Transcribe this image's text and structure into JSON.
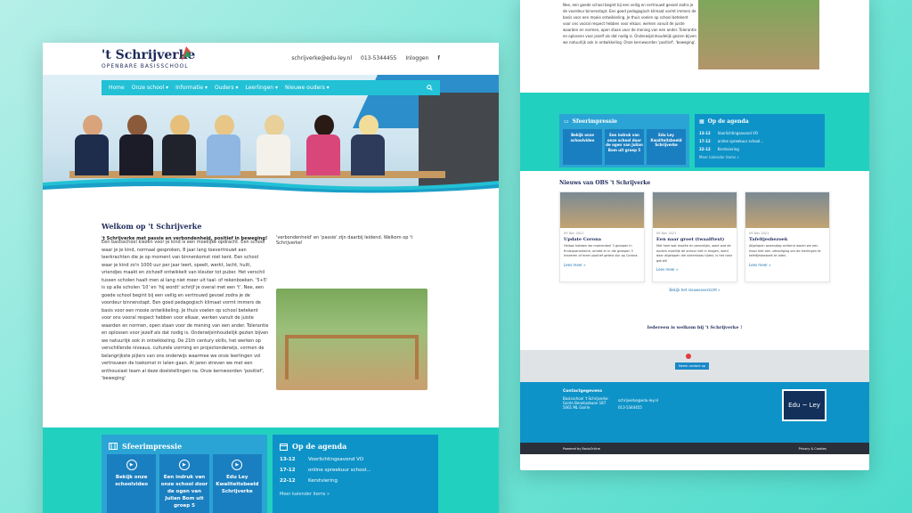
{
  "left": {
    "logo": {
      "name": "'t Schrijverke",
      "subtitle": "OPENBARE BASISSCHOOL"
    },
    "header": {
      "email": "schrijverke@edu-ley.nl",
      "phone": "013-5344455",
      "login": "Inloggen",
      "social": "f"
    },
    "nav": {
      "items": [
        "Home",
        "Onze school ▾",
        "Informatie ▾",
        "Ouders ▾",
        "Leerlingen ▾",
        "Nieuwe ouders ▾"
      ],
      "search_icon": "search-icon"
    },
    "welcome_title": "Welkom op 't Schrijverke",
    "tagline": "'t Schrijverke met passie en verbondenheid, positief in beweging!",
    "tagline2": "'verbondenheid' en 'passie' zijn daarbij leidend. Welkom op 't Schrijverke!",
    "body_text": "Een basisschool kiezen voor je kind is een moeilijke opdracht. Een school waar je je kind, normaal gesproken, 8 jaar lang toevertrouwt aan leerkrachten die je op moment van binnenkomst niet kent. Een school waar je kind zo'n 1000 uur per jaar leert, speelt, werkt, lacht, huilt, vriendjes maakt en zichzelf ontwikkelt van kleuter tot puber. Het verschil tussen scholen haalt men al lang niet meer uit taal- of rekenboeken. '5+5' is op alle scholen '10' en 'hij wordt' schrijf je overal met een 't'. Nee, een goede school begint bij een veilig en vertrouwd gevoel zodra je de voordeur binnenstapt. Een goed pedagogisch klimaat vormt immers de basis voor een mooie ontwikkeling. Je thuis voelen op school betekent voor ons vooral respect hebben voor elkaar, werken vanuit de juiste waarden en normen, open staan voor de mening van een ander. Tolerantie en oplossen voor jezelf als dat nodig is. Onderwijsinhoudelijk gezien bijven we natuurlijk ook in ontwikkeling. De 21th century skills, het werken op verschillende niveaus, culturele vorming en projectonderwijs, vormen de belangrijkste pijlers van ons onderwijs waarmee we onze leerlingen vol vertrouwen de toekomst in laten gaan. Al jaren streven we met een enthousiast team al deze doelstellingen na. Onze kernwoorden 'positief', 'beweging'",
    "sfeer": {
      "title": "Sfeerimpressie",
      "tiles": [
        "Bekijk onze schoolvideo",
        "Een indruk van onze school door de ogen van Julian Bom uit groep 5",
        "Edu Ley Kwaliteitsbeeld Schrijverke"
      ]
    },
    "agenda": {
      "title": "Op de agenda",
      "rows": [
        {
          "date": "13-12",
          "text": "Voorlichtingsavond VO"
        },
        {
          "date": "17-12",
          "text": "online spreekuur school..."
        },
        {
          "date": "22-12",
          "text": "Kerstviering"
        }
      ],
      "link": "Meer kalender items »"
    }
  },
  "right": {
    "intro_text": "Nee, een goede school begint bij een veilig en vertrouwd gevoel zodra je de voordeur binnenstapt. Een goed pedagogisch klimaat vormt immers de basis voor een mooie ontwikkeling. Je thuis voelen op school betekent voor ons vooral respect hebben voor elkaar, werken vanuit de juiste waarden en normen, open staan voor de mening van een ander. Tolerantie en oplossen voor jezelf als dat nodig is. Onderwijsinhoudelijk gezien bijven we natuurlijk ook in ontwikkeling. Onze kernwoorden 'positief', 'beweging'.",
    "sfeer": {
      "title": "Sfeerimpressie",
      "tiles": [
        "Bekijk onze schoolvideo",
        "Een indruk van onze school door de ogen van Julian Bom uit groep 5",
        "Edu Ley Kwaliteitsbeeld Schrijverke"
      ]
    },
    "agenda": {
      "title": "Op de agenda",
      "rows": [
        {
          "date": "13-12",
          "text": "Voorlichtingsavond VO"
        },
        {
          "date": "17-12",
          "text": "online spreekuur school..."
        },
        {
          "date": "22-12",
          "text": "Kerstviering"
        }
      ],
      "link": "Meer kalender items »"
    },
    "news": {
      "title": "Nieuws van OBS 't Schrijverke",
      "items": [
        {
          "date": "09 Dec 2021",
          "title": "Update Corona",
          "desc": "Helaas hebben we momenteel 3 groepen in thuisquarantaine, omdat er in die groepen 3 kinderen of meer positief getest zijn op Corona.",
          "more": "Lees meer »"
        },
        {
          "date": "09 Dec 2021",
          "title": "Een naar groet (twaalftext)",
          "desc": "Met heel wat moeite en pennetjes, want wat de ouders moeilijk de school niet in mogen, werd daar afgelopen die sinterklaas tijden, is het naar gelukt!",
          "more": "Lees meer »"
        },
        {
          "date": "09 Dec 2021",
          "title": "Tafeltjesbezoek",
          "desc": "Afgelopen woensdag ochtend waren we een mooi met een uitnodiging om de leerlingen te tafeltjesbezoek te laten.",
          "more": "Lees meer »"
        }
      ],
      "all": "Bekijk het nieuwsoverzicht »"
    },
    "welcome": "Iedereen is welkom bij 't Schrijverke !",
    "map_button": "Neem contact op",
    "footer": {
      "title": "Contactgegevens",
      "lines": [
        "Basisschool 't Schrijverke",
        "Goirle Beneluxbaan 187",
        "5061 ML Goirle"
      ],
      "email": "schrijverke@edu-ley.nl",
      "phone": "013-5344455",
      "logo": "Edu ~ Ley"
    },
    "bottom": {
      "left": "Powered by BasisOnline",
      "right": "Privacy & Cookies"
    }
  }
}
